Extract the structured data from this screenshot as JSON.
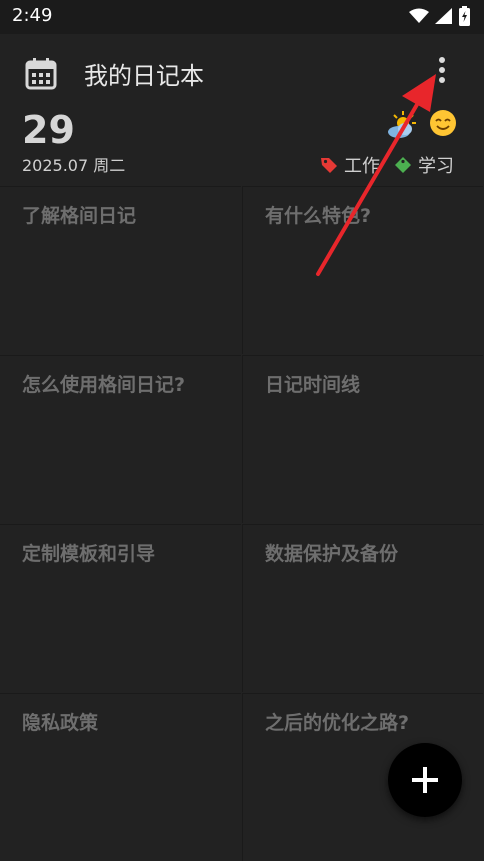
{
  "status_bar": {
    "time": "2:49"
  },
  "app_bar": {
    "title": "我的日记本"
  },
  "date_header": {
    "day": "29",
    "date_line": "2025.07 周二",
    "tags": [
      {
        "label": "工作",
        "color": "#e53935",
        "icon": "tag-icon"
      },
      {
        "label": "学习",
        "color": "#4caf50",
        "icon": "tag-icon"
      }
    ],
    "weather_icon": "partly-sunny-icon",
    "mood_icon": "smile-face-icon"
  },
  "grid": {
    "cells": [
      {
        "title": "了解格间日记"
      },
      {
        "title": "有什么特色?"
      },
      {
        "title": "怎么使用格间日记?"
      },
      {
        "title": "日记时间线"
      },
      {
        "title": "定制模板和引导"
      },
      {
        "title": "数据保护及备份"
      },
      {
        "title": "隐私政策"
      },
      {
        "title": "之后的优化之路?"
      }
    ]
  },
  "fab": {
    "icon": "plus-icon"
  },
  "annotation": {
    "color": "#e8262b"
  }
}
